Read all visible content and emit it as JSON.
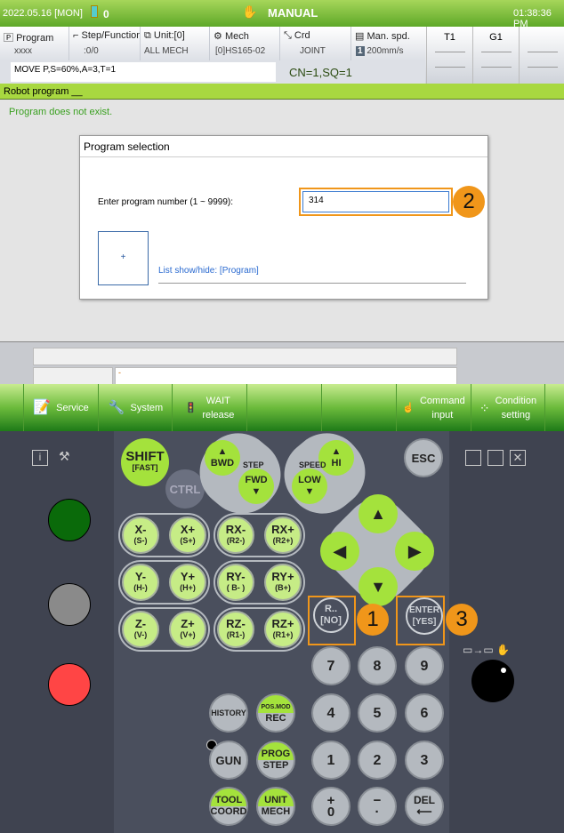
{
  "status": {
    "date": "2022.05.16 [MON]",
    "io_count": "0",
    "mode": "MANUAL",
    "time": "01:38:36 PM"
  },
  "info": {
    "program": {
      "label": "Program",
      "value": "xxxx"
    },
    "step": {
      "label": "Step/Function",
      "value": ":0/0"
    },
    "unit": {
      "label": "Unit:[0]",
      "value": "ALL MECH"
    },
    "mech": {
      "label": "Mech",
      "value": "[0]HS165-02"
    },
    "crd": {
      "label": "Crd",
      "value": "JOINT"
    },
    "speed": {
      "label": "Man. spd.",
      "level": "1",
      "value": "200mm/s"
    },
    "command": "MOVE P,S=60%,A=3,T=1",
    "cn_sq": "CN=1,SQ=1",
    "tabs": [
      "T1",
      "G1",
      ""
    ]
  },
  "section_title": "Robot program __",
  "message": "Program does not exist.",
  "dialog": {
    "title": "Program selection",
    "prompt": "Enter program number (1 ~ 9999):",
    "input_value": "314",
    "plus_label": "+",
    "list_link": "List show/hide: [Program]"
  },
  "annotations": [
    "1",
    "2",
    "3"
  ],
  "cmdline": {
    "value": "-"
  },
  "function_bar": [
    {
      "label": "Service",
      "icon": "notepad-icon"
    },
    {
      "label": "System",
      "icon": "system-icon"
    },
    {
      "label": "WAIT\nrelease",
      "icon": "traffic-light-icon"
    },
    {
      "label": ""
    },
    {
      "label": ""
    },
    {
      "label": "Command\ninput",
      "icon": "hand-pointer-icon"
    },
    {
      "label": "Condition\nsetting",
      "icon": "circles-icon"
    }
  ],
  "keys": {
    "shift": "SHIFT",
    "shift_sub": "[FAST]",
    "ctrl": "CTRL",
    "bwd": "BWD",
    "fwd": "FWD",
    "step": "STEP",
    "speed": "SPEED",
    "hi": "HI",
    "low": "LOW",
    "esc": "ESC",
    "axes": [
      [
        "X-",
        "(S-)"
      ],
      [
        "X+",
        "(S+)"
      ],
      [
        "RX-",
        "(R2-)"
      ],
      [
        "RX+",
        "(R2+)"
      ],
      [
        "Y-",
        "(H-)"
      ],
      [
        "Y+",
        "(H+)"
      ],
      [
        "RY-",
        "( B- )"
      ],
      [
        "RY+",
        "(B+)"
      ],
      [
        "Z-",
        "(V-)"
      ],
      [
        "Z+",
        "(V+)"
      ],
      [
        "RZ-",
        "(R1-)"
      ],
      [
        "RZ+",
        "(R1+)"
      ]
    ],
    "r": "R..",
    "r_sub": "[NO]",
    "enter": "ENTER",
    "enter_sub": "[YES]",
    "nums": [
      "7",
      "8",
      "9",
      "4",
      "5",
      "6",
      "1",
      "2",
      "3"
    ],
    "plus": "+",
    "zero": "0",
    "minus": "−",
    "dot": "·",
    "del": "DEL",
    "history": "HISTORY",
    "posmod": "POS.MOD",
    "rec": "REC",
    "gun": "GUN",
    "prog": "PROG",
    "step2": "STEP",
    "tool": "TOOL",
    "coord": "COORD",
    "unit": "UNIT",
    "mech": "MECH"
  },
  "colors": {
    "green": "#a8d840",
    "annotation": "#f0961a",
    "lamp_green": "#0a6a0a",
    "lamp_gray": "#8a8a8a",
    "lamp_red": "#ff4545"
  }
}
